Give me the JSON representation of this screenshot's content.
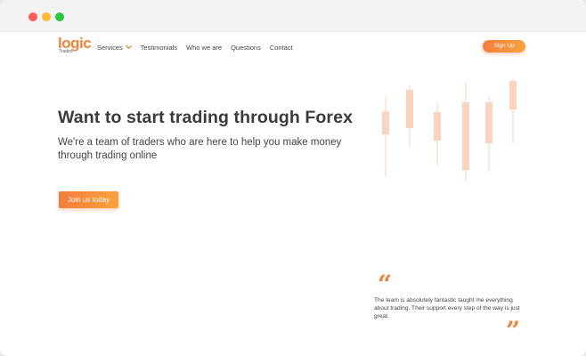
{
  "brand": {
    "name": "logic",
    "tagline": "Trades",
    "accent_color": "#f0843a",
    "accent_gradient_end": "#f9a33d",
    "candle_color": "#fbd4be"
  },
  "nav": {
    "items": [
      {
        "label": "Services",
        "has_dropdown": true
      },
      {
        "label": "Testimonials"
      },
      {
        "label": "Who we are"
      },
      {
        "label": "Questions"
      },
      {
        "label": "Contact"
      }
    ],
    "dropdown_icon": "chevron-down-icon"
  },
  "header": {
    "signup_label": "Sign Up"
  },
  "hero": {
    "title": "Want to start trading through Forex",
    "subtitle": "We're a team of traders who are here to help you make money through trading online",
    "cta_label": "Join us today"
  },
  "testimonial": {
    "open_quote_icon": "quote-open-icon",
    "close_quote_icon": "quote-close-icon",
    "text": "The team is absolutely fantastic taught me everything about trading. Their support every step of the way is just great."
  }
}
